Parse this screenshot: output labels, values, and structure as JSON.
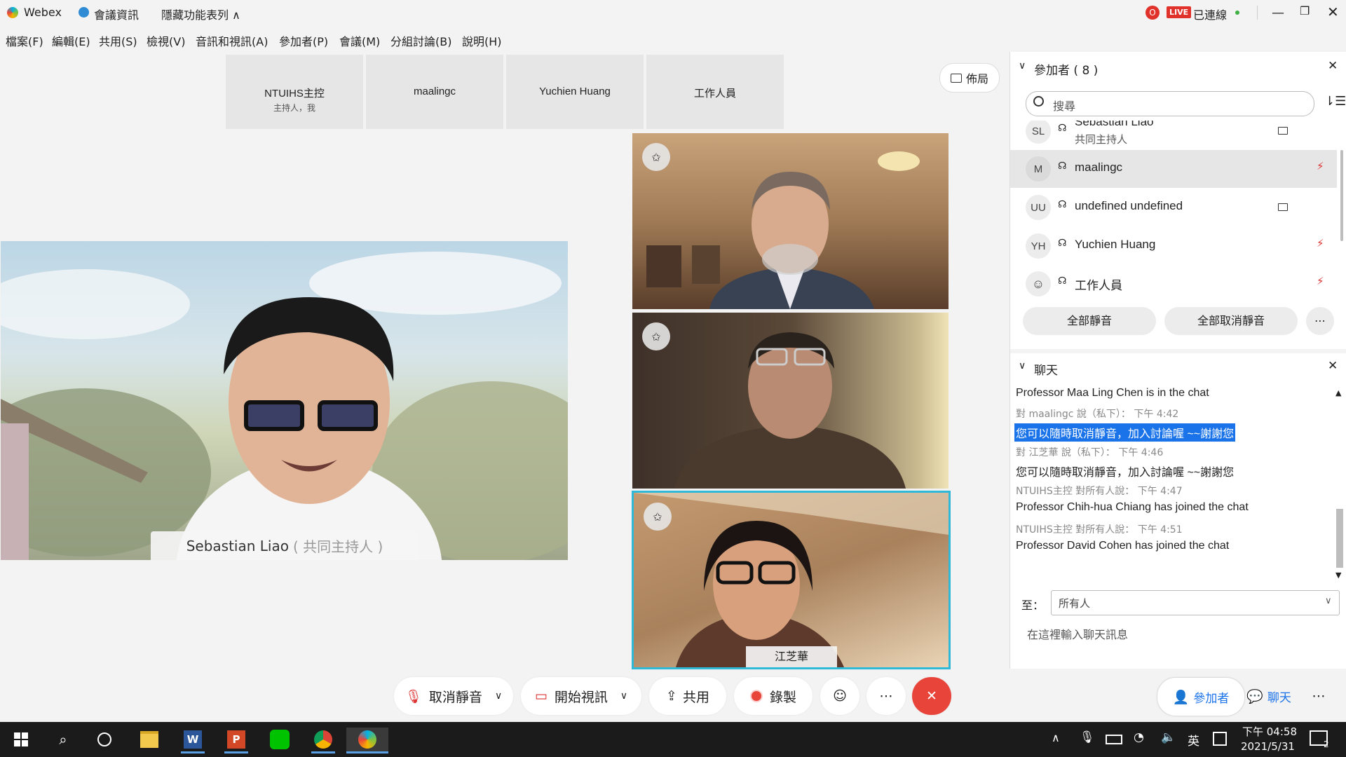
{
  "titlebar": {
    "app_name": "Webex",
    "meeting_info": "會議資訊",
    "hide_menu": "隱藏功能表列",
    "live_badge": "LIVE",
    "connected": "已連線"
  },
  "menubar": {
    "items": [
      "檔案(F)",
      "編輯(E)",
      "共用(S)",
      "檢視(V)",
      "音訊和視訊(A)",
      "參加者(P)",
      "會議(M)",
      "分組討論(B)",
      "說明(H)"
    ]
  },
  "layout_button": "佈局",
  "strip": [
    {
      "name": "NTUIHS主控",
      "sub": "主持人，我"
    },
    {
      "name": "maalingc",
      "sub": ""
    },
    {
      "name": "Yuchien Huang",
      "sub": ""
    },
    {
      "name": "工作人員",
      "sub": ""
    }
  ],
  "main_video": {
    "name": "Sebastian Liao",
    "role": "( 共同主持人 )"
  },
  "tiles": [
    {
      "label": ""
    },
    {
      "label": ""
    },
    {
      "label": "江芝華"
    }
  ],
  "participants_panel": {
    "title": "參加者 ( 8 )",
    "search_placeholder": "搜尋",
    "rows": [
      {
        "initials": "SL",
        "name": "Sebastian Liao",
        "sub": "共同主持人"
      },
      {
        "initials": "M",
        "name": "maalingc",
        "sub": ""
      },
      {
        "initials": "UU",
        "name": "undefined undefined",
        "sub": ""
      },
      {
        "initials": "YH",
        "name": "Yuchien Huang",
        "sub": ""
      },
      {
        "initials": "",
        "name": "工作人員",
        "sub": ""
      }
    ],
    "mute_all": "全部靜音",
    "unmute_all": "全部取消靜音"
  },
  "chat_panel": {
    "title": "聊天",
    "messages": [
      {
        "meta": "",
        "text": "Professor Maa Ling Chen is in the chat"
      },
      {
        "meta": "對 maalingc 說（私下）：    下午 4:42",
        "text": "您可以隨時取消靜音，加入討論喔 ~~謝謝您",
        "highlight": true
      },
      {
        "meta": "對 江芝華 說（私下）：    下午 4:46",
        "text": "您可以隨時取消靜音，加入討論喔 ~~謝謝您"
      },
      {
        "meta": "NTUIHS主控 對所有人說：    下午 4:47",
        "text": "Professor Chih-hua Chiang has joined the chat"
      },
      {
        "meta": "NTUIHS主控 對所有人說：    下午 4:51",
        "text": "Professor David Cohen has joined the chat"
      }
    ],
    "to_label": "至：",
    "to_value": "所有人",
    "input_placeholder": "在這裡輸入聊天訊息"
  },
  "controls": {
    "unmute": "取消靜音",
    "start_video": "開始視訊",
    "share": "共用",
    "record": "錄製",
    "participants": "參加者",
    "chat": "聊天"
  },
  "taskbar": {
    "ime": "英",
    "time": "下午 04:58",
    "date": "2021/5/31",
    "notif_count": "2"
  },
  "colors": {
    "accent": "#00a0d1",
    "end_call": "#e8443a",
    "live": "#e0312a",
    "highlight": "#1a73e8"
  }
}
